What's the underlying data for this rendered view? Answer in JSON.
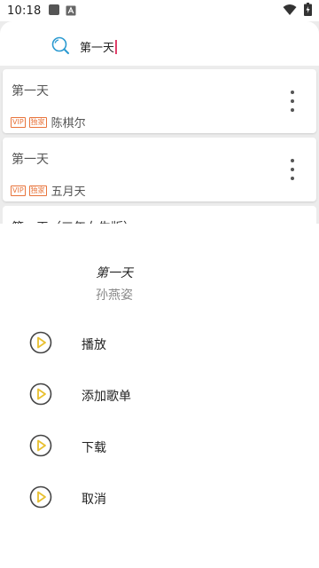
{
  "status_bar": {
    "time": "10:18",
    "icons": [
      "sim-icon",
      "notification-a-icon",
      "wifi-icon",
      "battery-icon"
    ]
  },
  "search": {
    "value": "第一天",
    "icon": "search-icon"
  },
  "results": [
    {
      "title": "第一天",
      "tags": [
        "VIP",
        "独家"
      ],
      "artist": "陈棋尔"
    },
    {
      "title": "第一天",
      "tags": [
        "VIP",
        "独家"
      ],
      "artist": "五月天"
    },
    {
      "title": "第一天（三年女生版）"
    }
  ],
  "sheet": {
    "song_title": "第一天",
    "artist": "孙燕姿",
    "actions": [
      {
        "label": "播放",
        "icon": "play-circle-icon"
      },
      {
        "label": "添加歌单",
        "icon": "play-circle-icon"
      },
      {
        "label": "下载",
        "icon": "play-circle-icon"
      },
      {
        "label": "取消",
        "icon": "play-circle-icon"
      }
    ]
  },
  "colors": {
    "accent": "#e0406a",
    "tag": "#e8743b",
    "icon_play": "#e8c030"
  }
}
